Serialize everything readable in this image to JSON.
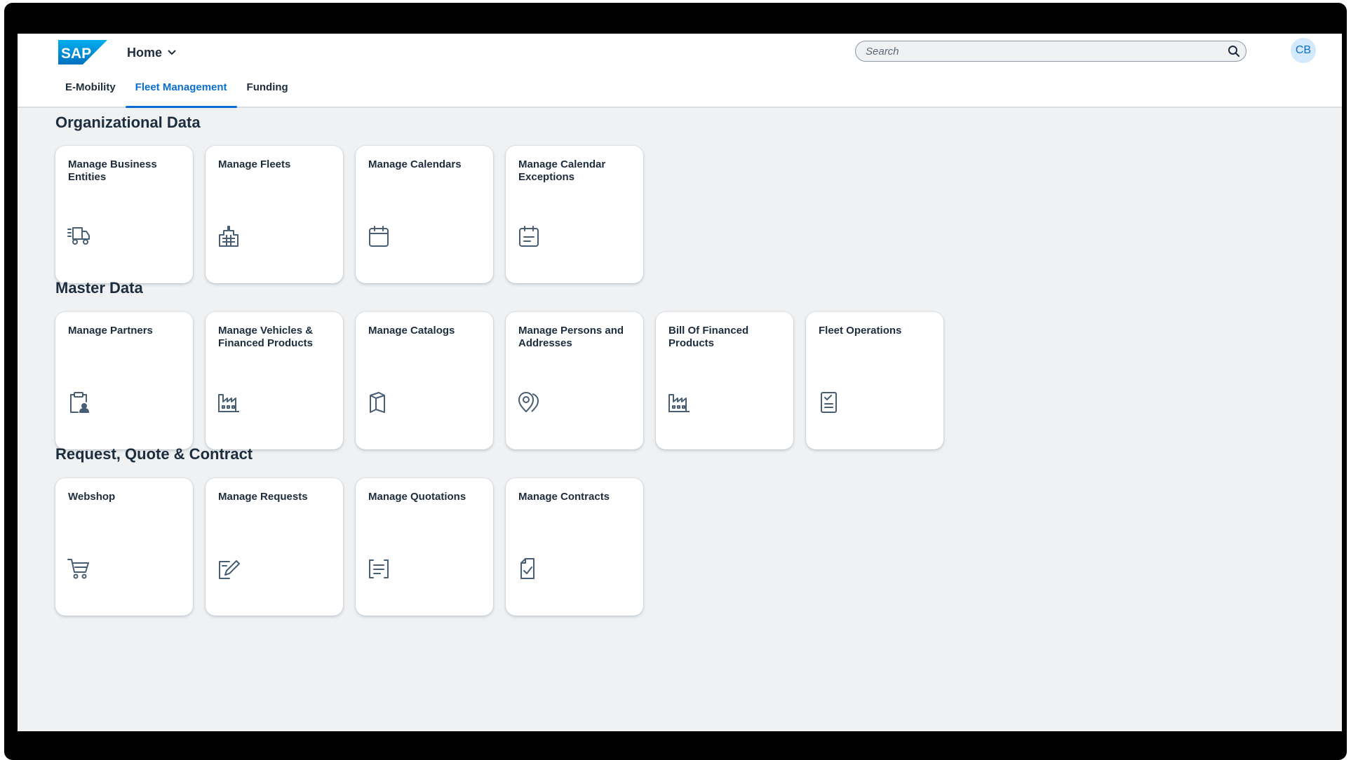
{
  "header": {
    "logo_text": "SAP",
    "home_label": "Home",
    "search_placeholder": "Search",
    "avatar_initials": "CB"
  },
  "tabs": [
    {
      "label": "E-Mobility",
      "active": false
    },
    {
      "label": "Fleet Management",
      "active": true
    },
    {
      "label": "Funding",
      "active": false
    }
  ],
  "sections": [
    {
      "title": "Organizational Data",
      "tiles": [
        {
          "title": "Manage Business Entities",
          "icon": "shipping-status-icon"
        },
        {
          "title": "Manage Fleets",
          "icon": "building-icon"
        },
        {
          "title": "Manage Calendars",
          "icon": "calendar-icon"
        },
        {
          "title": "Manage Calendar Exceptions",
          "icon": "appointment-icon"
        }
      ]
    },
    {
      "title": "Master Data",
      "tiles": [
        {
          "title": "Manage Partners",
          "icon": "clipboard-person-icon"
        },
        {
          "title": "Manage Vehicles & Financed Products",
          "icon": "factory-icon"
        },
        {
          "title": "Manage Catalogs",
          "icon": "catalog-icon"
        },
        {
          "title": "Manage Persons and Addresses",
          "icon": "map-pin-person-icon"
        },
        {
          "title": "Bill Of Financed Products",
          "icon": "factory-icon"
        },
        {
          "title": "Fleet Operations",
          "icon": "checklist-icon"
        }
      ]
    },
    {
      "title": "Request, Quote & Contract",
      "tiles": [
        {
          "title": "Webshop",
          "icon": "cart-icon"
        },
        {
          "title": "Manage Requests",
          "icon": "edit-document-icon"
        },
        {
          "title": "Manage Quotations",
          "icon": "quotation-icon"
        },
        {
          "title": "Manage Contracts",
          "icon": "signed-document-icon"
        }
      ]
    }
  ],
  "colors": {
    "brand_blue": "#0a6ed1",
    "text": "#1d2d3e",
    "background": "#eff1f3",
    "icon": "#475e75"
  }
}
